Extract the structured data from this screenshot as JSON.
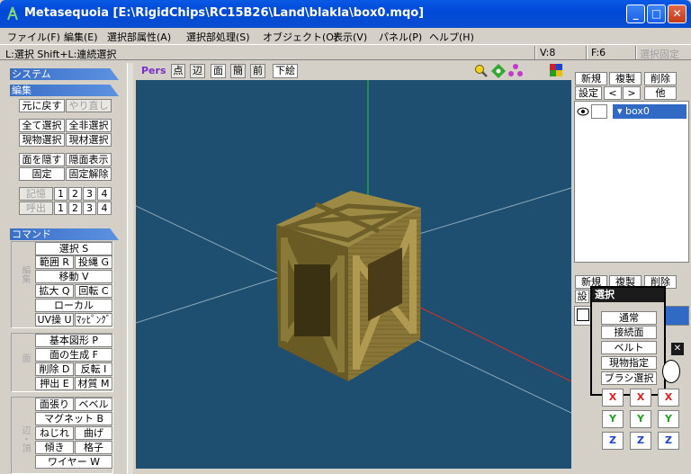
{
  "window": {
    "title": "Metasequoia [E:\\RigidChips\\RC15B26\\Land\\blakla\\box0.mqo]",
    "min": "_",
    "max": "□",
    "close": "✕"
  },
  "menu": [
    "ファイル(F)",
    "編集(E)",
    "選択部属性(A)",
    "選択部処理(S)",
    "オブジェクト(O)",
    "表示(V)",
    "パネル(P)",
    "ヘルプ(H)"
  ],
  "status": {
    "hint": "L:選択  Shift+L:連続選択",
    "v": "V:8",
    "f": "F:6",
    "lock": "選択固定"
  },
  "left": {
    "system": "システム",
    "edit": "編集",
    "undo": "元に戻す",
    "redo": "やり直し",
    "selall": "全て選択",
    "deselall": "全非選択",
    "selcur": "現物選択",
    "selmat": "現材選択",
    "hide": "面を隠す",
    "showhid": "隠面表示",
    "fix": "固定",
    "unfix": "固定解除",
    "mem": "記憶",
    "recall": "呼出",
    "nums": [
      "1",
      "2",
      "3",
      "4"
    ],
    "command": "コマンド",
    "sel": "選択 S",
    "range": "範囲 R",
    "lasso": "投縄 G",
    "move": "移動 V",
    "scale": "拡大 Q",
    "rotate": "回転 C",
    "local": "ローカル",
    "uv": "UV操 U",
    "mapping": "ﾏｯﾋﾟﾝｸﾞ",
    "shape": "基本図形 P",
    "genface": "面の生成 F",
    "del": "削除 D",
    "flip": "反転 I",
    "extrude": "押出 E",
    "material": "材質 M",
    "stretch": "面張り",
    "bevel": "ベベル",
    "magnet": "マグネット B",
    "twist": "ねじれ",
    "bend": "曲げ",
    "tilt": "傾き",
    "grid": "格子",
    "wire": "ワイヤー W",
    "grp1": "編集",
    "grp2": "面",
    "grp3": "辺・頂"
  },
  "viewbar": {
    "pers": "Pers",
    "pt": "点",
    "edge": "辺",
    "face": "面",
    "simple": "簡",
    "front": "前",
    "draft": "下絵"
  },
  "right": {
    "new": "新規",
    "dup": "複製",
    "del": "削除",
    "settings": "設定",
    "prev": "<",
    "next": ">",
    "other": "他",
    "obj": "box0",
    "new2": "新規",
    "dup2": "複製",
    "del2": "削除",
    "set2": "設"
  },
  "popup": {
    "title": "選択",
    "items": [
      "通常",
      "接続面",
      "ベルト",
      "現物指定",
      "ブラシ選択"
    ]
  },
  "axes": {
    "x": "X",
    "y": "Y",
    "z": "Z"
  },
  "colors": {
    "viewport": "#1e4e70",
    "titlebar": "#0a4ed0",
    "crate": "#8c7a3a"
  }
}
